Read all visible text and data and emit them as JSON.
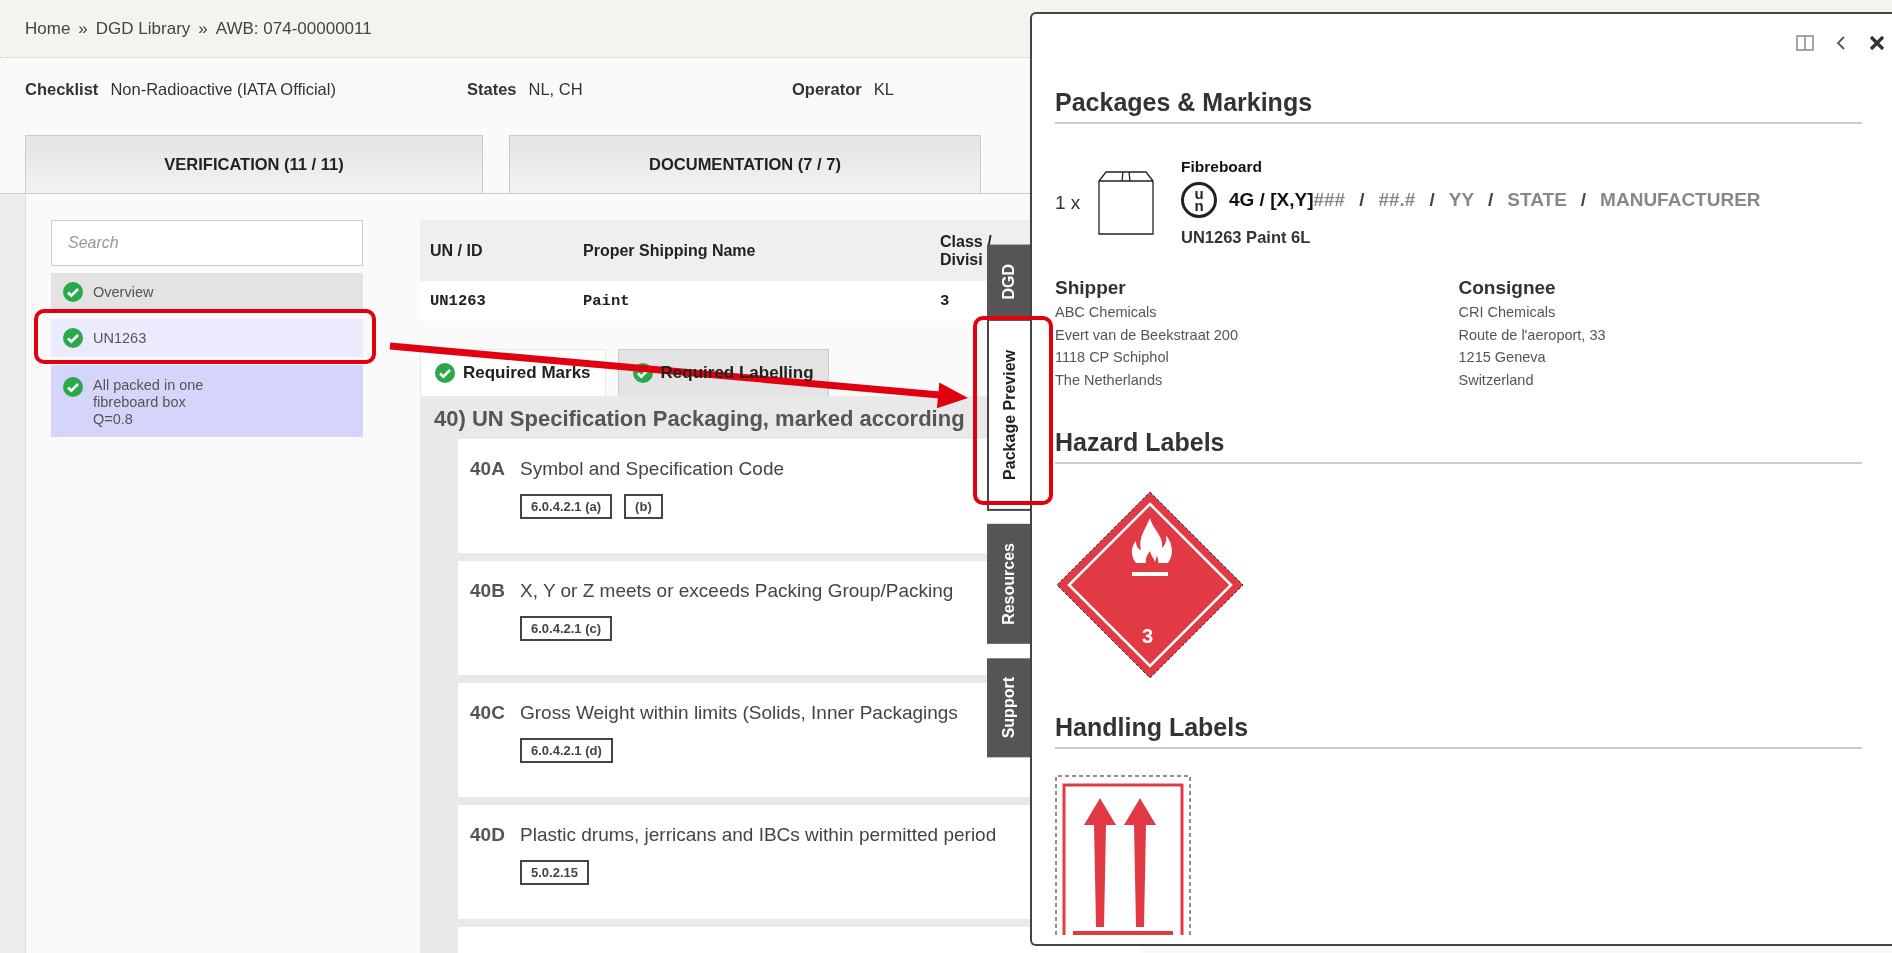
{
  "breadcrumb": {
    "items": [
      "Home",
      "DGD Library",
      "AWB: 074-00000011"
    ],
    "separators": [
      "»",
      "»"
    ]
  },
  "info": [
    {
      "label": "Checklist",
      "value": "Non-Radioactive (IATA Official)"
    },
    {
      "label": "States",
      "value": "NL, CH"
    },
    {
      "label": "Operator",
      "value": "KL"
    }
  ],
  "main_tabs": [
    {
      "label": "VERIFICATION (11 / 11)"
    },
    {
      "label": "DOCUMENTATION (7 / 7)"
    }
  ],
  "sidebar": {
    "search": {
      "placeholder": "Search"
    },
    "items": [
      {
        "kind": "item",
        "lines": [
          "Overview"
        ],
        "checked": true,
        "selected": false
      },
      {
        "kind": "item",
        "lines": [
          "UN1263"
        ],
        "checked": true,
        "selected": true
      },
      {
        "kind": "package",
        "lines": [
          "All packed in one",
          "fibreboard box",
          "Q=0.8"
        ],
        "checked": true,
        "selected": false
      }
    ]
  },
  "table": {
    "columns": [
      "UN / ID",
      "Proper Shipping Name",
      "Class / Divisi"
    ],
    "rows": [
      [
        "UN1263",
        "Paint",
        "3"
      ]
    ]
  },
  "subtabs": [
    {
      "label": "Required Marks",
      "checked": true,
      "selected": true
    },
    {
      "label": "Required Labelling",
      "checked": true,
      "selected": false
    }
  ],
  "section": {
    "title": "40) UN Specification Packaging, marked according",
    "items": [
      {
        "code": "40A",
        "title": "Symbol and Specification Code",
        "refs": [
          "6.0.4.2.1 (a)",
          "(b)"
        ]
      },
      {
        "code": "40B",
        "title": "X, Y or Z meets or exceeds Packing Group/Packing",
        "refs": [
          "6.0.4.2.1 (c)"
        ]
      },
      {
        "code": "40C",
        "title": "Gross Weight within limits (Solids, Inner Packagings",
        "refs": [
          "6.0.4.2.1 (d)"
        ]
      },
      {
        "code": "40D",
        "title": "Plastic drums, jerricans and IBCs within permitted period",
        "refs": [
          "5.0.2.15"
        ]
      }
    ]
  },
  "side_tabs": [
    {
      "label": "DGD",
      "selected": false
    },
    {
      "label": "Package Preview",
      "selected": true
    },
    {
      "label": "Resources",
      "selected": false
    },
    {
      "label": "Support",
      "selected": false
    }
  ],
  "panel": {
    "title": "Packages & Markings",
    "package": {
      "quantity": "1 x",
      "material": "Fibreboard",
      "un_symbol": "un",
      "marking": [
        {
          "kind": "fixed",
          "text": "4G / [X,Y]"
        },
        {
          "kind": "placeholder",
          "text": "###"
        },
        {
          "kind": "separator",
          "text": "/"
        },
        {
          "kind": "placeholder",
          "text": "##.#"
        },
        {
          "kind": "separator",
          "text": "/"
        },
        {
          "kind": "placeholder",
          "text": "YY"
        },
        {
          "kind": "separator",
          "text": "/"
        },
        {
          "kind": "placeholder",
          "text": "STATE"
        },
        {
          "kind": "separator",
          "text": "/"
        },
        {
          "kind": "placeholder",
          "text": "MANUFACTURER"
        }
      ],
      "content": "UN1263 Paint 6L"
    },
    "parties": [
      {
        "heading": "Shipper",
        "lines": [
          "ABC Chemicals",
          "Evert van de Beekstraat 200",
          "1118 CP Schiphol",
          "The Netherlands"
        ]
      },
      {
        "heading": "Consignee",
        "lines": [
          "CRI Chemicals",
          "Route de l'aeroport, 33",
          "1215 Geneva",
          "Switzerland"
        ]
      }
    ],
    "hazard_labels": {
      "title": "Hazard Labels",
      "labels": [
        {
          "kind": "flammable-liquid",
          "class": "3"
        }
      ]
    },
    "handling_labels": {
      "title": "Handling Labels",
      "labels": [
        {
          "kind": "this-way-up"
        }
      ]
    }
  }
}
